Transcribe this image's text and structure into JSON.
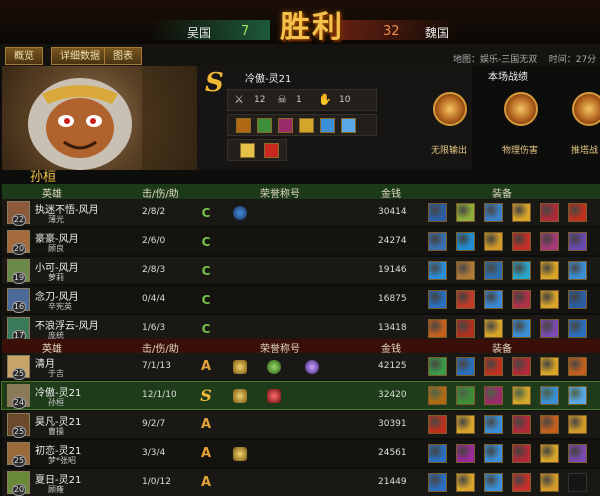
{
  "header": {
    "team_left": "吴国",
    "score_left": "7",
    "team_right": "魏国",
    "score_right": "32",
    "result": "胜利"
  },
  "tabs": [
    "概览",
    "详细数据",
    "图表"
  ],
  "info": {
    "map": "地图：娱乐-三国无双",
    "time": "时间：",
    "time_value": "27分"
  },
  "hero_card": {
    "hero_name": "孙桓",
    "grade": "S",
    "player_name": "冷傲-灵21",
    "stats": [
      "12",
      "1",
      "10"
    ],
    "stat_icons": [
      "sword-icon",
      "skull-icon",
      "hand-icon"
    ],
    "item_colors": [
      "#b06a14",
      "#3f8f3a",
      "#9a2a6a",
      "#d1a62a",
      "#3a8fd6",
      "#5aa9e6"
    ],
    "honor_colors": [
      "#e7c04a",
      "#c8281e"
    ]
  },
  "battle_panel": {
    "title": "本场战绩",
    "medals": [
      "无限输出",
      "物理伤害",
      "推塔战"
    ]
  },
  "team1": {
    "headers": {
      "hero": "英雄",
      "kda": "击/伤/助",
      "honor": "荣誉称号",
      "gold": "金钱",
      "gear": "装备"
    },
    "players": [
      {
        "name": "执迷不悟-风月",
        "level": "22",
        "hero": "薄光",
        "kda": "2/8/2",
        "gold": "30414",
        "honors": [
          "C",
          "x"
        ],
        "avatar": "#8a5a3a",
        "items": [
          "#2a5fa8",
          "#8fae3a",
          "#3a7fc6",
          "#d8a42a",
          "#b02a3a",
          "#c0301e"
        ]
      },
      {
        "name": "豪豪-风月",
        "level": "20",
        "hero": "顾良",
        "kda": "2/6/0",
        "gold": "24274",
        "honors": [
          "C"
        ],
        "avatar": "#a46a3c",
        "items": [
          "#3a6fb2",
          "#1f8fd6",
          "#d29a2a",
          "#c4302a",
          "#a83a7a",
          "#6a4ab2"
        ]
      },
      {
        "name": "小可-风月",
        "level": "19",
        "hero": "萝莉",
        "kda": "2/8/3",
        "gold": "19146",
        "honors": [
          "C"
        ],
        "avatar": "#6a8a4a",
        "items": [
          "#2a8fd6",
          "#b07a3a",
          "#2f6fb0",
          "#2aa6c8",
          "#d8a42a",
          "#3a8fd6"
        ]
      },
      {
        "name": "念刀-风月",
        "level": "16",
        "hero": "辛宪英",
        "kda": "0/4/4",
        "gold": "16875",
        "honors": [
          "C"
        ],
        "avatar": "#4a6a9a",
        "items": [
          "#2a6fc0",
          "#c43a2a",
          "#3a8ad6",
          "#b0304a",
          "#d8a42a",
          "#2a5fa8"
        ]
      },
      {
        "name": "不浪浮云-风月",
        "level": "17",
        "hero": "庞统",
        "kda": "1/6/3",
        "gold": "13418",
        "honors": [
          "C"
        ],
        "avatar": "#3a7a5a",
        "items": [
          "#c4601e",
          "#b0301e",
          "#d8a42a",
          "#3a8fd6",
          "#7a4ab2",
          "#2a6fc0"
        ]
      }
    ]
  },
  "team2": {
    "headers": {
      "hero": "英雄",
      "kda": "击/伤/助",
      "honor": "荣誉称号",
      "gold": "金钱",
      "gear": "装备"
    },
    "players": [
      {
        "name": "清月",
        "level": "25",
        "hero": "于吉",
        "kda": "7/1/13",
        "gold": "42125",
        "honors": [
          "A",
          "y",
          "g",
          "p"
        ],
        "avatar": "#c8a46a",
        "items": [
          "#3a9a4a",
          "#2a6fc0",
          "#c0301e",
          "#b02a3a",
          "#d8a42a",
          "#c4601e"
        ]
      },
      {
        "name": "冷傲-灵21",
        "level": "24",
        "hero": "孙桓",
        "kda": "12/1/10",
        "gold": "32420",
        "honors": [
          "S",
          "y",
          "z"
        ],
        "avatar": "#8a7a5a",
        "items": [
          "#b06a14",
          "#3f8f3a",
          "#9a2a6a",
          "#d1a62a",
          "#3a8fd6",
          "#5aa9e6"
        ]
      },
      {
        "name": "昊凡-灵21",
        "level": "25",
        "hero": "曹操",
        "kda": "9/2/7",
        "gold": "30391",
        "honors": [
          "A"
        ],
        "avatar": "#6a4a2a",
        "items": [
          "#c0301e",
          "#d8a42a",
          "#3a8fd6",
          "#b02a3a",
          "#c4601e",
          "#d29a2a"
        ]
      },
      {
        "name": "初恋-灵21",
        "level": "25",
        "hero": "梦*张昭",
        "kda": "3/3/4",
        "gold": "24561",
        "honors": [
          "A",
          "y"
        ],
        "avatar": "#9a6a3a",
        "items": [
          "#2a6fc0",
          "#9a2a9a",
          "#3a8fd6",
          "#b02a3a",
          "#d8a42a",
          "#7a4ab2"
        ]
      },
      {
        "name": "夏日-灵21",
        "level": "20",
        "hero": "顾雍",
        "kda": "1/0/12",
        "gold": "21449",
        "honors": [
          "A"
        ],
        "avatar": "#6a8a3a",
        "items": [
          "#2a6fc0",
          "#d8a42a",
          "#3a8fd6",
          "#c4302a",
          "#d29a2a",
          ""
        ]
      }
    ]
  },
  "colors": {
    "accent_gold": "#f3c343",
    "team_left": "#1e5a3a",
    "team_right": "#6a2212",
    "highlight_row": "#1e3c1a"
  }
}
